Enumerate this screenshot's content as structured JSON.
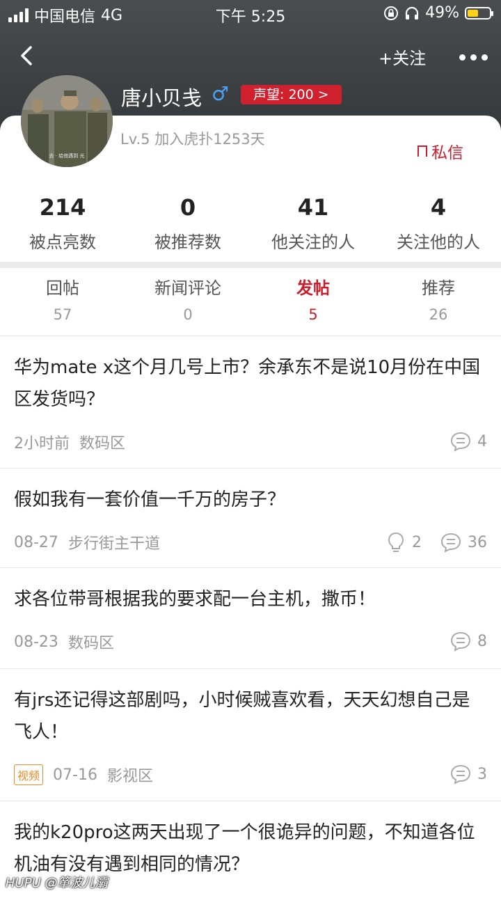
{
  "status_bar": {
    "carrier": "中国电信",
    "network": "4G",
    "time": "下午 5:25",
    "battery": "49%",
    "battery_level": 0.49
  },
  "nav": {
    "follow_label": "+关注"
  },
  "profile": {
    "username": "唐小贝戋",
    "gender_symbol": "♂",
    "reputation": "声望: 200 >",
    "level_info": "Lv.5 加入虎扑1253天",
    "pm_label": "私信",
    "avatar_caption": "去 · 给他遇到 光"
  },
  "stats": [
    {
      "value": "214",
      "label": "被点亮数"
    },
    {
      "value": "0",
      "label": "被推荐数"
    },
    {
      "value": "41",
      "label": "他关注的人"
    },
    {
      "value": "4",
      "label": "关注他的人"
    }
  ],
  "tabs": [
    {
      "label": "回帖",
      "count": "57",
      "active": false
    },
    {
      "label": "新闻评论",
      "count": "0",
      "active": false
    },
    {
      "label": "发帖",
      "count": "5",
      "active": true
    },
    {
      "label": "推荐",
      "count": "26",
      "active": false
    }
  ],
  "posts": [
    {
      "title": "华为mate x这个月几号上市？余承东不是说10月份在中国区发货吗？",
      "time": "2小时前",
      "board": "数码区",
      "video_tag": "",
      "lights": "",
      "replies": "4"
    },
    {
      "title": "假如我有一套价值一千万的房子？",
      "time": "08-27",
      "board": "步行街主干道",
      "video_tag": "",
      "lights": "2",
      "replies": "36"
    },
    {
      "title": "求各位带哥根据我的要求配一台主机，撒币！",
      "time": "08-23",
      "board": "数码区",
      "video_tag": "",
      "lights": "",
      "replies": "8"
    },
    {
      "title": "有jrs还记得这部剧吗，小时候贼喜欢看，天天幻想自己是飞人！",
      "time": "07-16",
      "board": "影视区",
      "video_tag": "视频",
      "lights": "",
      "replies": "3"
    },
    {
      "title": "我的k20pro这两天出现了一个很诡异的问题，不知道各位机油有没有遇到相同的情况？",
      "time": "",
      "board": "",
      "video_tag": "",
      "lights": "",
      "replies": ""
    }
  ],
  "watermark": "HUPU @箪波儿灞",
  "colors": {
    "accent": "#c81e2c",
    "header_bg": "#3d4043",
    "gender": "#4aa3f5",
    "video_tag": "#f08a24"
  }
}
